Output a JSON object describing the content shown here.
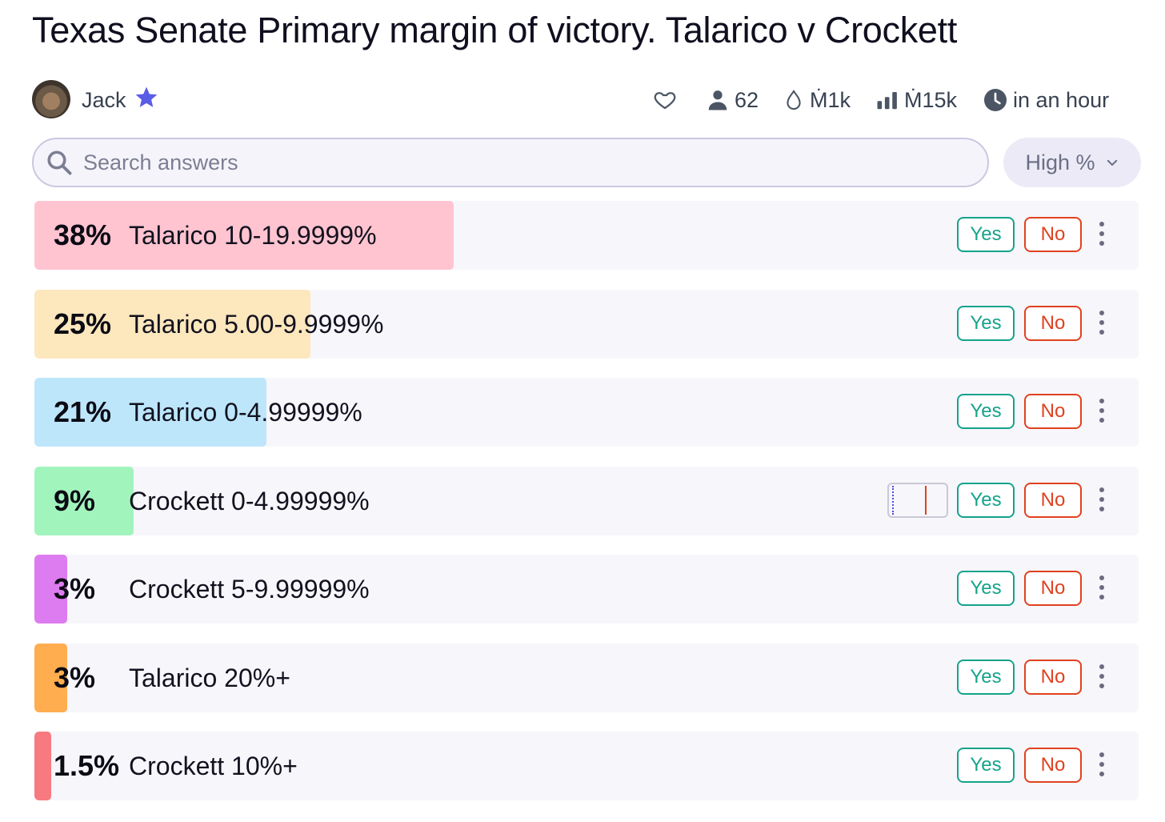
{
  "page": {
    "title": "Texas Senate Primary margin of victory. Talarico v Crockett"
  },
  "author": {
    "name": "Jack",
    "avatar_icon": "user-avatar",
    "badge_icon": "star-icon"
  },
  "stats": {
    "traders": "62",
    "liquidity": "Ṁ1k",
    "volume": "Ṁ15k",
    "closes": "in an hour"
  },
  "search": {
    "placeholder": "Search answers",
    "value": ""
  },
  "sort": {
    "label": "High %"
  },
  "answers": [
    {
      "pct": "38%",
      "value": 0.38,
      "label": "Talarico 10-19.9999%",
      "color": "#ffc4d0",
      "yes": "Yes",
      "no": "No"
    },
    {
      "pct": "25%",
      "value": 0.25,
      "label": "Talarico 5.00-9.9999%",
      "color": "#fde7bd",
      "yes": "Yes",
      "no": "No"
    },
    {
      "pct": "21%",
      "value": 0.21,
      "label": "Talarico 0-4.99999%",
      "color": "#bde6fb",
      "yes": "Yes",
      "no": "No"
    },
    {
      "pct": "9%",
      "value": 0.09,
      "label": "Crockett 0-4.99999%",
      "color": "#a2f4bd",
      "yes": "Yes",
      "no": "No"
    },
    {
      "pct": "3%",
      "value": 0.03,
      "label": "Crockett 5-9.99999%",
      "color": "#dd7cf0",
      "yes": "Yes",
      "no": "No"
    },
    {
      "pct": "3%",
      "value": 0.03,
      "label": "Talarico 20%+",
      "color": "#ffad4f",
      "yes": "Yes",
      "no": "No"
    },
    {
      "pct": "1.5%",
      "value": 0.015,
      "label": "Crockett 10%+",
      "color": "#f77a80",
      "yes": "Yes",
      "no": "No"
    }
  ]
}
